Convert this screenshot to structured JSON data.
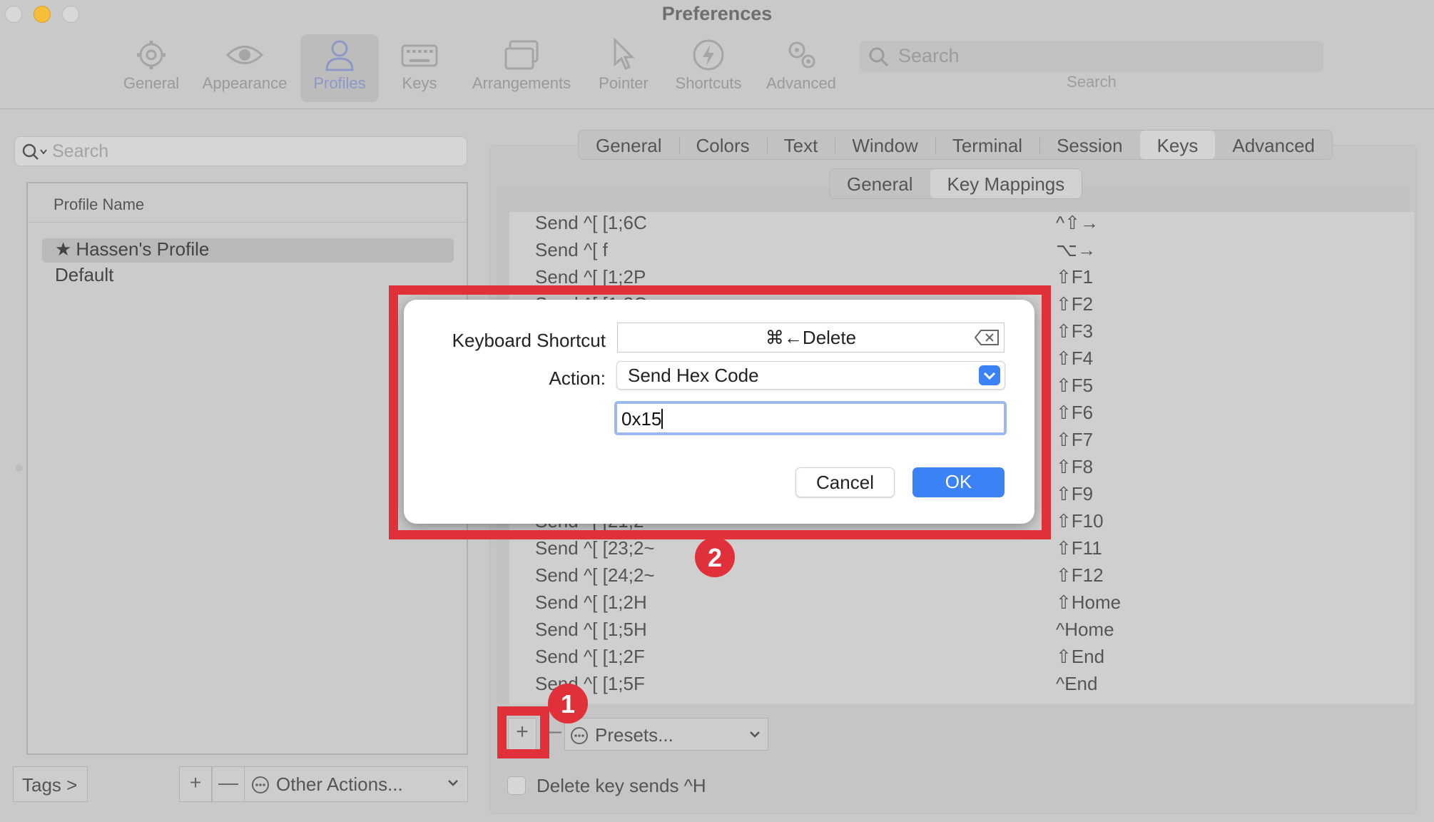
{
  "window": {
    "title": "Preferences"
  },
  "toolbar": {
    "items": [
      {
        "label": "General",
        "icon": "gear-icon"
      },
      {
        "label": "Appearance",
        "icon": "eye-icon"
      },
      {
        "label": "Profiles",
        "icon": "person-icon",
        "active": true
      },
      {
        "label": "Keys",
        "icon": "keyboard-icon"
      },
      {
        "label": "Arrangements",
        "icon": "windows-icon"
      },
      {
        "label": "Pointer",
        "icon": "pointer-icon"
      },
      {
        "label": "Shortcuts",
        "icon": "lightning-icon"
      },
      {
        "label": "Advanced",
        "icon": "gears-icon"
      }
    ],
    "search_placeholder": "Search",
    "search_label": "Search"
  },
  "left": {
    "search_placeholder": "Search",
    "header": "Profile Name",
    "profiles": [
      {
        "name": "Hassen's Profile",
        "star": "★",
        "selected": true
      },
      {
        "name": "Default"
      }
    ],
    "tags_label": "Tags >",
    "add": "+",
    "remove": "—",
    "other_actions": "Other Actions..."
  },
  "tabs": [
    "General",
    "Colors",
    "Text",
    "Window",
    "Terminal",
    "Session",
    "Keys",
    "Advanced"
  ],
  "active_tab": "Keys",
  "subtabs": [
    "General",
    "Key Mappings"
  ],
  "active_subtab": "Key Mappings",
  "mappings": [
    {
      "action": "Send ^[ [1;6C",
      "shortcut": "^⇧→"
    },
    {
      "action": "Send ^[ f",
      "shortcut": "⌥→"
    },
    {
      "action": "Send ^[ [1;2P",
      "shortcut": "⇧F1"
    },
    {
      "action": "Send ^[ [1;2Q",
      "shortcut": "⇧F2"
    },
    {
      "action": "",
      "shortcut": "⇧F3"
    },
    {
      "action": "",
      "shortcut": "⇧F4"
    },
    {
      "action": "",
      "shortcut": "⇧F5"
    },
    {
      "action": "",
      "shortcut": "⇧F6"
    },
    {
      "action": "",
      "shortcut": "⇧F7"
    },
    {
      "action": "",
      "shortcut": "⇧F8"
    },
    {
      "action": "",
      "shortcut": "⇧F9"
    },
    {
      "action": "Send ^[ [21;2~",
      "shortcut": "⇧F10"
    },
    {
      "action": "Send ^[ [23;2~",
      "shortcut": "⇧F11"
    },
    {
      "action": "Send ^[ [24;2~",
      "shortcut": "⇧F12"
    },
    {
      "action": "Send ^[ [1;2H",
      "shortcut": "⇧Home"
    },
    {
      "action": "Send ^[ [1;5H",
      "shortcut": "^Home"
    },
    {
      "action": "Send ^[ [1;2F",
      "shortcut": "⇧End"
    },
    {
      "action": "Send ^[ [1;5F",
      "shortcut": "^End"
    }
  ],
  "bottom": {
    "add": "+",
    "remove": "—",
    "presets": "Presets...",
    "delete_key_label": "Delete key sends ^H"
  },
  "dialog": {
    "shortcut_label": "Keyboard Shortcut",
    "shortcut_value": "⌘←Delete",
    "action_label": "Action:",
    "action_value": "Send Hex Code",
    "hex_value": "0x15",
    "cancel": "Cancel",
    "ok": "OK"
  },
  "annotations": {
    "badge1": "1",
    "badge2": "2"
  },
  "colors": {
    "accent": "#3b82f6",
    "annotation": "#e0313a"
  }
}
